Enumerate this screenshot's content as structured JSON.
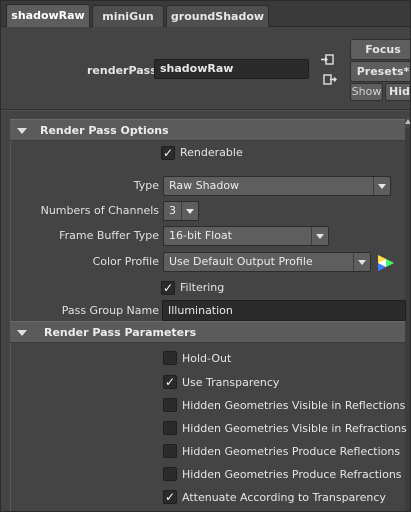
{
  "tabs": [
    {
      "label": "shadowRaw",
      "active": true
    },
    {
      "label": "miniGun",
      "active": false
    },
    {
      "label": "groundShadow",
      "active": false
    }
  ],
  "header": {
    "render_pass_label": "renderPass:",
    "render_pass_value": "shadowRaw",
    "focus_label": "Focus",
    "presets_label": "Presets*",
    "show_label": "Show",
    "hide_label": "Hid",
    "icons": [
      "input-connection-icon",
      "output-connection-icon"
    ]
  },
  "render_pass_options": {
    "title": "Render Pass Options",
    "renderable": {
      "label": "Renderable",
      "checked": true
    },
    "type": {
      "label": "Type",
      "value": "Raw Shadow"
    },
    "channels": {
      "label": "Numbers of Channels",
      "value": "3"
    },
    "frame_buffer": {
      "label": "Frame Buffer Type",
      "value": "16-bit Float"
    },
    "color_profile": {
      "label": "Color Profile",
      "value": "Use Default Output Profile",
      "icon": "color-wheel-icon"
    },
    "filtering": {
      "label": "Filtering",
      "checked": true
    },
    "pass_group": {
      "label": "Pass Group Name",
      "value": "Illumination"
    }
  },
  "render_pass_parameters": {
    "title": "Render Pass Parameters",
    "options": [
      {
        "label": "Hold-Out",
        "checked": false
      },
      {
        "label": "Use Transparency",
        "checked": true
      },
      {
        "label": "Hidden Geometries Visible in Reflections",
        "checked": false
      },
      {
        "label": "Hidden Geometries Visible in Refractions",
        "checked": false
      },
      {
        "label": "Hidden Geometries Produce Reflections",
        "checked": false
      },
      {
        "label": "Hidden Geometries Produce Refractions",
        "checked": false
      },
      {
        "label": "Attenuate According to Transparency",
        "checked": true
      }
    ]
  },
  "colors": {
    "background": "#444444",
    "section_header": "#5b5b5b",
    "field_dark": "#2b2b2b",
    "button": "#5e5e5e"
  }
}
